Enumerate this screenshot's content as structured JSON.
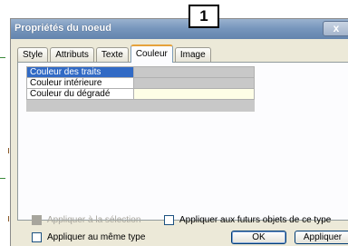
{
  "dialog": {
    "title": "Propriétés du noeud",
    "close_label": "x"
  },
  "callout": {
    "label": "1"
  },
  "tabs": [
    {
      "label": "Style"
    },
    {
      "label": "Attributs"
    },
    {
      "label": "Texte"
    },
    {
      "label": "Couleur"
    },
    {
      "label": "Image"
    }
  ],
  "active_tab": "Couleur",
  "color_properties": [
    {
      "label": "Couleur des traits"
    },
    {
      "label": "Couleur intérieure"
    },
    {
      "label": "Couleur du dégradé"
    }
  ],
  "options": {
    "apply_selection": "Appliquer à la sélection",
    "apply_future": "Appliquer aux futurs objets de ce type",
    "apply_same_type": "Appliquer au même type"
  },
  "buttons": {
    "ok": "OK",
    "apply": "Appliquer"
  },
  "colors": {
    "selection": "#316ac5",
    "titlebar": "#7897bd",
    "dialog_bg": "#ece9d8"
  }
}
